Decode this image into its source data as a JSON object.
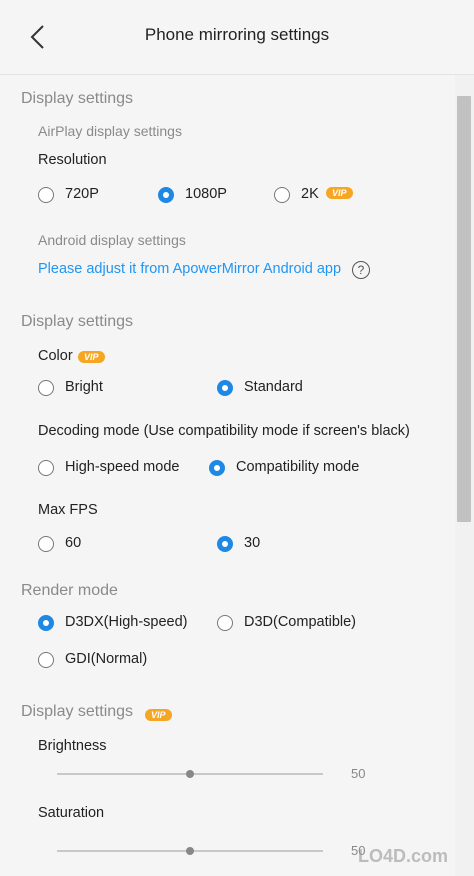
{
  "header": {
    "title": "Phone mirroring settings"
  },
  "display1": {
    "title": "Display settings",
    "airplay": {
      "title": "AirPlay display settings",
      "resolution_label": "Resolution",
      "options": [
        "720P",
        "1080P",
        "2K"
      ],
      "selected": "1080P",
      "vip_badge": "VIP"
    },
    "android": {
      "title": "Android display settings",
      "link": "Please adjust it from ApowerMirror Android app",
      "help": "?"
    }
  },
  "display2": {
    "title": "Display settings",
    "color": {
      "label": "Color",
      "vip_badge": "VIP",
      "options": [
        "Bright",
        "Standard"
      ],
      "selected": "Standard"
    },
    "decoding": {
      "label": "Decoding mode (Use compatibility mode if screen's black)",
      "options": [
        "High-speed mode",
        "Compatibility mode"
      ],
      "selected": "Compatibility mode"
    },
    "fps": {
      "label": "Max FPS",
      "options": [
        "60",
        "30"
      ],
      "selected": "30"
    }
  },
  "render": {
    "title": "Render mode",
    "options": [
      "D3DX(High-speed)",
      "D3D(Compatible)",
      "GDI(Normal)"
    ],
    "selected": "D3DX(High-speed)"
  },
  "display3": {
    "title": "Display settings",
    "vip_badge": "VIP",
    "brightness": {
      "label": "Brightness",
      "value": "50",
      "level": 0.5
    },
    "saturation": {
      "label": "Saturation",
      "value": "50",
      "level": 0.5
    }
  },
  "watermark": "LO4D.com",
  "colors": {
    "accent": "#1e88e5",
    "link": "#2196f3",
    "vip": "#f5a623"
  }
}
